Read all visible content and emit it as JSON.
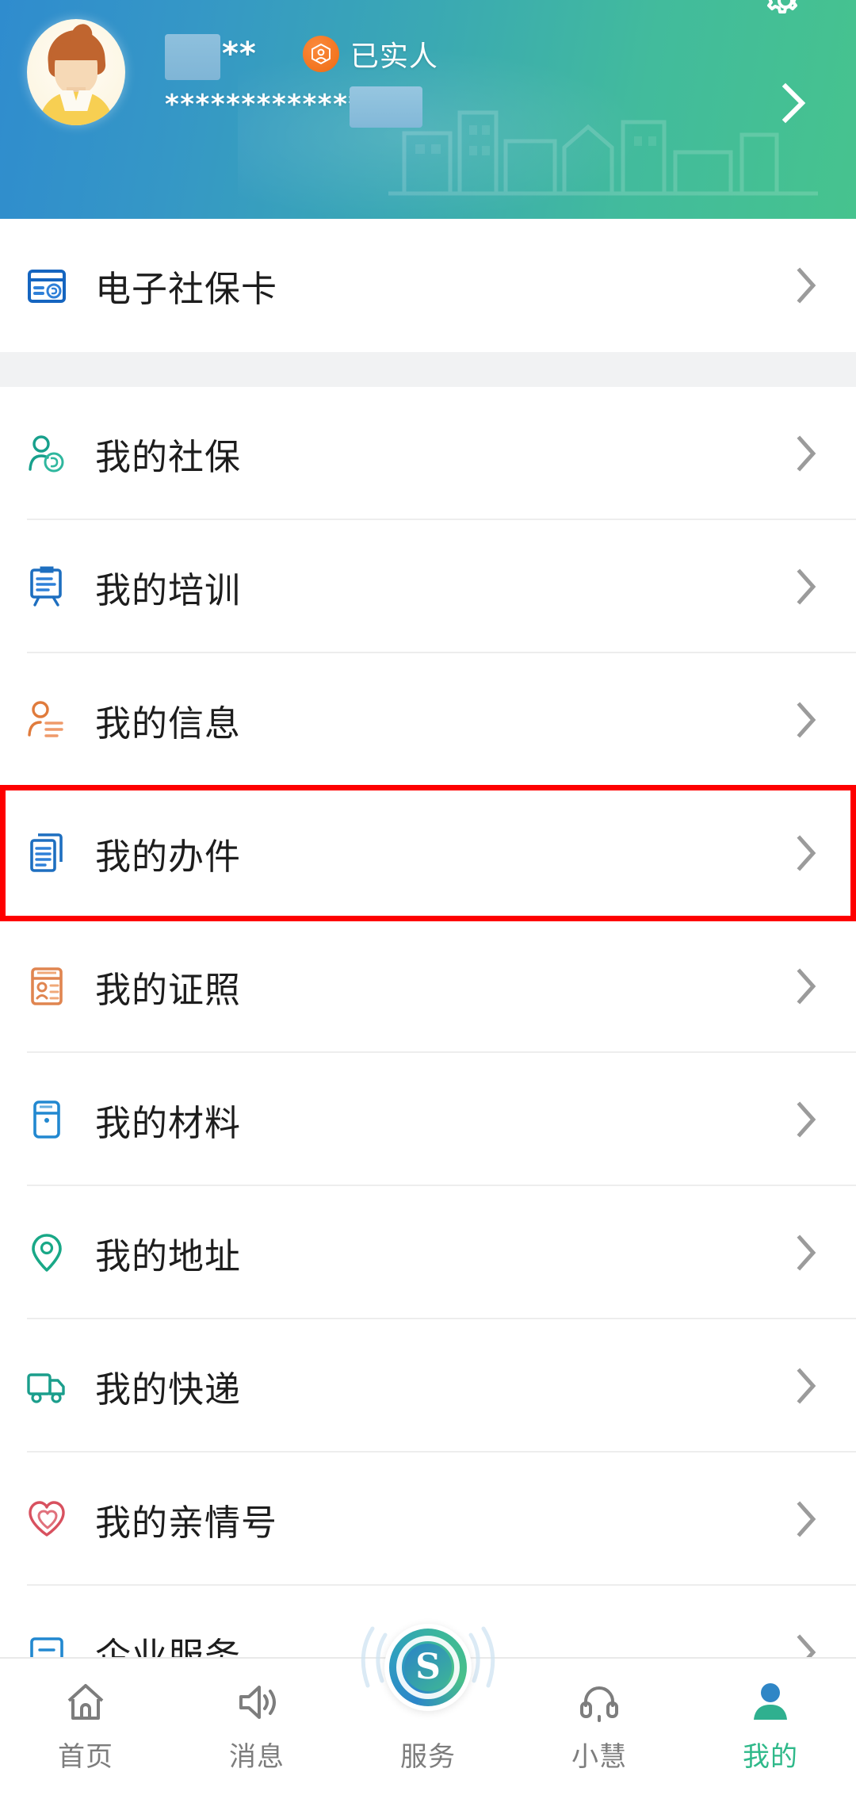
{
  "header": {
    "name_masked": "**",
    "verified_label": "已实人",
    "id_masked": "*************",
    "gear_icon": "gear-icon",
    "chevron_icon": "chevron-right-icon",
    "accent_blue": "#2f8cce",
    "accent_green": "#46c38e",
    "verify_orange": "#f2741f"
  },
  "menu": {
    "top_group": [
      {
        "label": "电子社保卡",
        "icon": "social-security-card-icon",
        "color": "#1565c0"
      }
    ],
    "main_group": [
      {
        "label": "我的社保",
        "icon": "person-social-security-icon",
        "color": "#17a08c"
      },
      {
        "label": "我的培训",
        "icon": "training-board-icon",
        "color": "#1e6fc0"
      },
      {
        "label": "我的信息",
        "icon": "person-info-icon",
        "color": "#e07b3c"
      },
      {
        "label": "我的办件",
        "icon": "documents-icon",
        "color": "#1e6fc0"
      },
      {
        "label": "我的证照",
        "icon": "id-certificate-icon",
        "color": "#e08550"
      },
      {
        "label": "我的材料",
        "icon": "material-folder-icon",
        "color": "#2288d0"
      },
      {
        "label": "我的地址",
        "icon": "location-pin-icon",
        "color": "#19a887"
      },
      {
        "label": "我的快递",
        "icon": "delivery-truck-icon",
        "color": "#1b9e8c"
      },
      {
        "label": "我的亲情号",
        "icon": "double-heart-icon",
        "color": "#d8515f"
      },
      {
        "label": "企业服务",
        "icon": "enterprise-service-icon",
        "color": "#2288d0"
      }
    ]
  },
  "highlight": {
    "target_label": "我的办件",
    "border_color": "#fe0000"
  },
  "tabbar": {
    "items": [
      {
        "label": "首页",
        "icon": "home-icon",
        "active": false
      },
      {
        "label": "消息",
        "icon": "speaker-icon",
        "active": false
      },
      {
        "label": "服务",
        "icon": "service-badge-logo",
        "active": false
      },
      {
        "label": "小慧",
        "icon": "headset-icon",
        "active": false
      },
      {
        "label": "我的",
        "icon": "person-icon",
        "active": true
      }
    ],
    "active_color": "#2fb98a",
    "inactive_color": "#7d7d7d"
  }
}
